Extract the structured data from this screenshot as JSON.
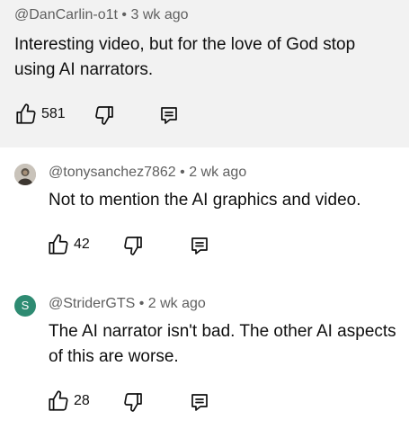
{
  "comments": [
    {
      "handle": "@DanCarlin-o1t",
      "time": "3 wk ago",
      "text": "Interesting video, but for the love of God stop using AI narrators.",
      "likes": "581"
    }
  ],
  "replies": [
    {
      "handle": "@tonysanchez7862",
      "time": "2 wk ago",
      "text": "Not to mention the AI graphics and video.",
      "likes": "42",
      "avatar": "photo-avatar"
    },
    {
      "handle": "@StriderGTS",
      "time": "2 wk ago",
      "text": "The AI narrator isn't bad. The other AI aspects of this are worse.",
      "likes": "28",
      "avatar_letter": "S",
      "avatar_color": "#2e8b72"
    }
  ],
  "separator": "•",
  "icons": {
    "like": "thumbs-up-icon",
    "dislike": "thumbs-down-icon",
    "reply": "reply-comment-icon"
  }
}
